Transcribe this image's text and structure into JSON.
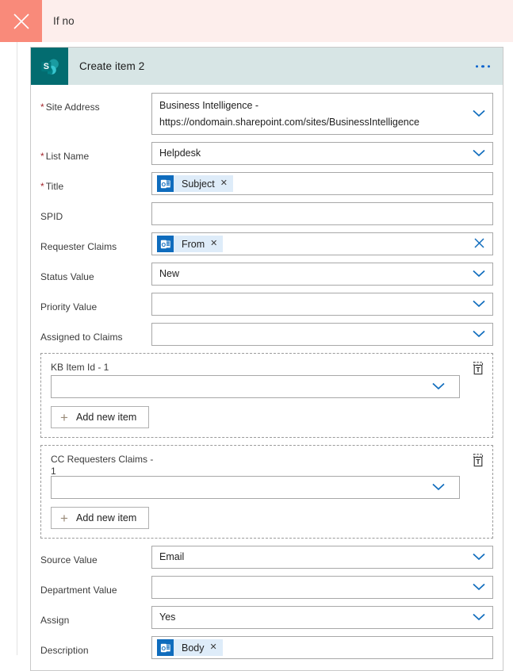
{
  "branch_bar": {
    "title": "If no",
    "close_icon": "close-icon",
    "accent_color": "#f98a7a",
    "background_color": "#fdeeec"
  },
  "card": {
    "title": "Create item 2",
    "connector_icon": "sharepoint-icon",
    "connector_letter": "S",
    "header_color": "#d7e5e5",
    "icon_color": "#036c70",
    "overflow_icon": "ellipsis-icon"
  },
  "fields": [
    {
      "label": "Site Address",
      "required": true,
      "type": "combo",
      "value_line1": "Business Intelligence -",
      "value_line2": "https://ondomain.sharepoint.com/sites/BusinessIntelligence",
      "chevron_icon": "chevron-down-icon"
    },
    {
      "label": "List Name",
      "required": true,
      "type": "combo",
      "value": "Helpdesk",
      "chevron_icon": "chevron-down-icon"
    },
    {
      "label": "Title",
      "required": true,
      "type": "token",
      "token": {
        "text": "Subject",
        "icon": "outlook-icon",
        "remove_icon": "remove-token-icon"
      }
    },
    {
      "label": "SPID",
      "required": false,
      "type": "text",
      "value": ""
    },
    {
      "label": "Requester Claims",
      "required": false,
      "type": "token",
      "token": {
        "text": "From",
        "icon": "outlook-icon",
        "remove_icon": "remove-token-icon"
      },
      "clear_icon": "clear-field-icon"
    },
    {
      "label": "Status Value",
      "required": false,
      "type": "combo",
      "value": "New",
      "chevron_icon": "chevron-down-icon"
    },
    {
      "label": "Priority Value",
      "required": false,
      "type": "combo",
      "value": "",
      "chevron_icon": "chevron-down-icon"
    },
    {
      "label": "Assigned to Claims",
      "required": false,
      "type": "combo",
      "value": "",
      "chevron_icon": "chevron-down-icon"
    }
  ],
  "repeating_sections": [
    {
      "label": "KB Item Id - 1",
      "label_line1": "KB Item Id - 1",
      "label_line2": "",
      "value": "",
      "add_button": "Add new item",
      "add_icon": "plus-icon",
      "delete_icon": "delete-item-icon",
      "chevron_icon": "chevron-down-icon"
    },
    {
      "label": "CC Requesters Claims - 1",
      "label_line1": "CC Requesters Claims -",
      "label_line2": "1",
      "value": "",
      "add_button": "Add new item",
      "add_icon": "plus-icon",
      "delete_icon": "delete-item-icon",
      "chevron_icon": "chevron-down-icon"
    }
  ],
  "fields_bottom": [
    {
      "label": "Source Value",
      "required": false,
      "type": "combo",
      "value": "Email",
      "chevron_icon": "chevron-down-icon"
    },
    {
      "label": "Department Value",
      "required": false,
      "type": "combo",
      "value": "",
      "chevron_icon": "chevron-down-icon"
    },
    {
      "label": "Assign",
      "required": false,
      "type": "combo",
      "value": "Yes",
      "chevron_icon": "chevron-down-icon"
    },
    {
      "label": "Description",
      "required": false,
      "type": "token",
      "token": {
        "text": "Body",
        "icon": "outlook-icon",
        "remove_icon": "remove-token-icon"
      }
    }
  ]
}
